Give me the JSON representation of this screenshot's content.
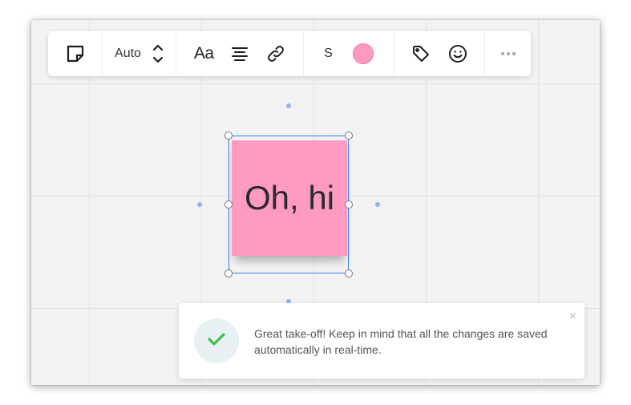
{
  "toolbar": {
    "icons": {
      "sticky_note": "sticky-note-icon",
      "size_stepper": "up-down-arrows-icon",
      "align": "align-center-icon",
      "link": "link-icon",
      "tag": "tag-icon",
      "emoji": "smiley-icon",
      "more": "more-horizontal-icon"
    },
    "size_mode": "Auto",
    "font_label": "Aa",
    "text_size": "S",
    "note_color": "#ff99c2"
  },
  "sticky_note": {
    "text": "Oh, hi",
    "color": "#ff9ac3"
  },
  "selection_color": "#2f80ed",
  "toast": {
    "message": "Great take-off! Keep in mind that all the changes are saved automatically in real-time.",
    "icon": "checkmark-icon",
    "icon_color": "#3fbf4a",
    "close_label": "×"
  }
}
